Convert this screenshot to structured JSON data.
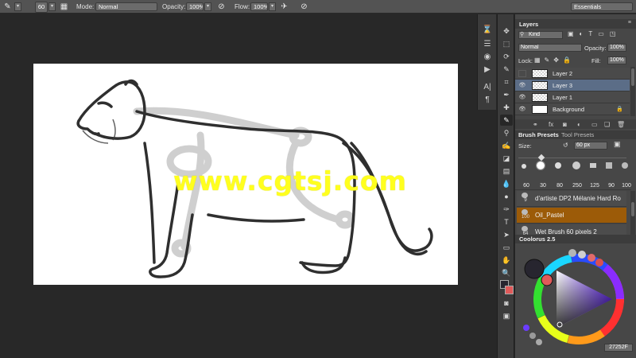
{
  "options_bar": {
    "brush_size": "60",
    "mode_label": "Mode:",
    "mode_value": "Normal",
    "opacity_label": "Opacity:",
    "opacity_value": "100%",
    "flow_label": "Flow:",
    "flow_value": "100%",
    "workspace": "Essentials"
  },
  "canvas": {
    "watermark": "www.cgtsj.com"
  },
  "layers_panel": {
    "tab": "Layers",
    "kind_label": "Kind",
    "blend_mode": "Normal",
    "opacity_label": "Opacity:",
    "opacity_value": "100%",
    "lock_label": "Lock:",
    "fill_label": "Fill:",
    "fill_value": "100%",
    "layers": [
      {
        "name": "Layer 2",
        "visible": false,
        "selected": false
      },
      {
        "name": "Layer 3",
        "visible": true,
        "selected": true
      },
      {
        "name": "Layer 1",
        "visible": true,
        "selected": false
      },
      {
        "name": "Background",
        "visible": true,
        "selected": false,
        "locked": true
      }
    ]
  },
  "brush_panel": {
    "tab_presets": "Brush Presets",
    "tab_tool": "Tool Presets",
    "size_label": "Size:",
    "size_value": "60 px",
    "tip_sizes": [
      "60",
      "30",
      "80",
      "250",
      "125",
      "90",
      "100"
    ],
    "presets": [
      {
        "name": "d'artiste DP2 Mélanie Hard Ro",
        "size": "9",
        "selected": false
      },
      {
        "name": "Oil_Pastel",
        "size": "100",
        "selected": true
      },
      {
        "name": "Wet Brush 60 pixels 2",
        "size": "64",
        "selected": false
      }
    ]
  },
  "coolorus": {
    "title": "Coolorus 2.5",
    "hex_value": "27252F"
  },
  "colors": {
    "accent_selection": "#5b6d87",
    "preset_selected": "#9c5b08",
    "watermark": "#ffff1e",
    "foreground": "#27252f",
    "background_swatch": "#e05a5a"
  }
}
